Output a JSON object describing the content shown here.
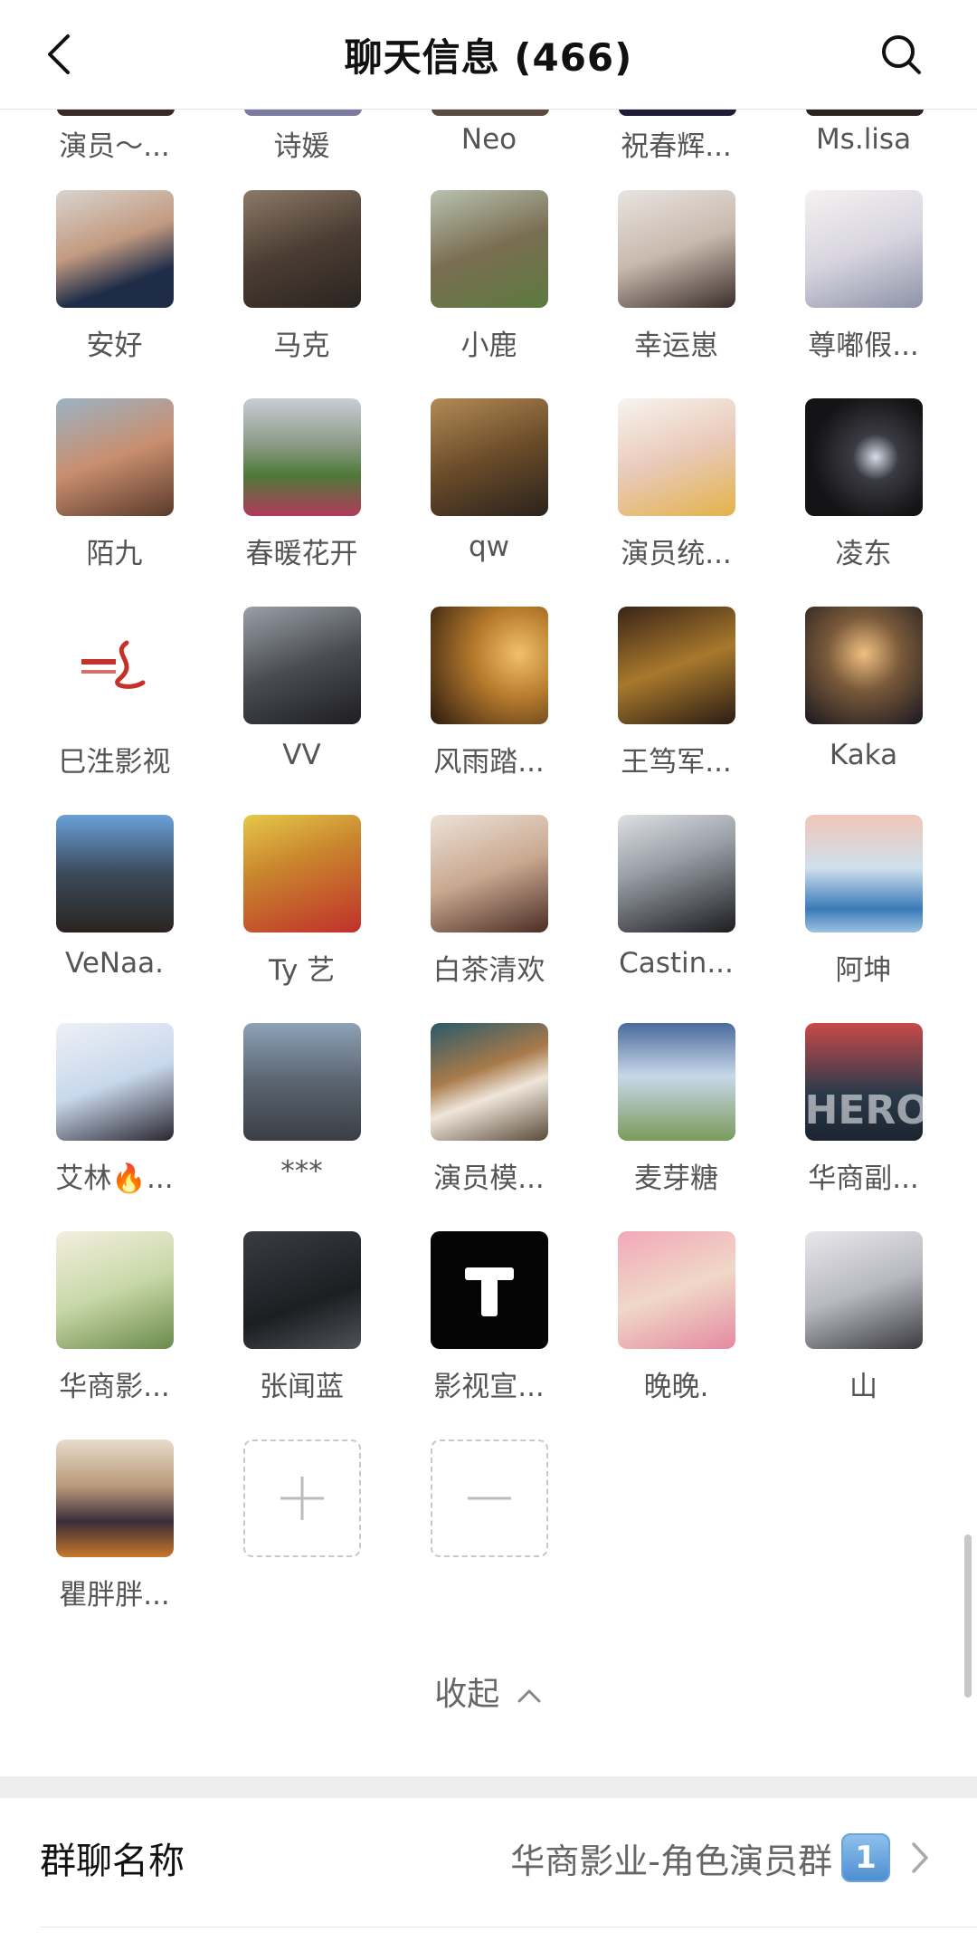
{
  "header": {
    "title": "聊天信息 (466)"
  },
  "partial_row": [
    {
      "name": "演员～...",
      "color": "#3a2a26"
    },
    {
      "name": "诗媛",
      "color": "#7d7aa0"
    },
    {
      "name": "Neo",
      "color": "#5a4a3f"
    },
    {
      "name": "祝春辉...",
      "color": "#1f1c3a"
    },
    {
      "name": "Ms.lisa",
      "color": "#2c2323"
    }
  ],
  "members": [
    {
      "name": "安好",
      "icon": "avatar-photo",
      "bg": "linear-gradient(160deg,#d9d4cf 0%,#c29a80 45%,#1e2c48 75%)"
    },
    {
      "name": "马克",
      "icon": "avatar-photo",
      "bg": "linear-gradient(160deg,#8c7a68 0%,#4b3d33 50%,#2a2420 100%)"
    },
    {
      "name": "小鹿",
      "icon": "avatar-photo",
      "bg": "linear-gradient(160deg,#b8c2b0 0%,#7a6e52 50%,#5c7a3e 100%)"
    },
    {
      "name": "幸运崽",
      "icon": "avatar-photo",
      "bg": "linear-gradient(160deg,#e8e4e0 0%,#c9b9ad 50%,#3a2e2a 100%)"
    },
    {
      "name": "尊嘟假...",
      "icon": "avatar-illustration",
      "bg": "linear-gradient(160deg,#f4f2f0 0%,#d8d5e0 50%,#8e93a8 100%)"
    },
    {
      "name": "陌九",
      "icon": "avatar-illustration",
      "bg": "linear-gradient(160deg,#9ab3c4 0%,#c98e6e 50%,#5a3a2c 100%)"
    },
    {
      "name": "春暖花开",
      "icon": "avatar-photo",
      "bg": "linear-gradient(180deg,#c9ced6 0%,#8a9a84 40%,#4e7a3a 65%,#b03a5a 100%)"
    },
    {
      "name": "qw",
      "icon": "avatar-photo",
      "bg": "linear-gradient(160deg,#b28a55 0%,#6b4c2a 50%,#2a221c 100%)"
    },
    {
      "name": "演员统...",
      "icon": "avatar-illustration",
      "bg": "linear-gradient(160deg,#f7f4f0 0%,#e9c9b8 50%,#e3b34a 100%)"
    },
    {
      "name": "凌东",
      "icon": "avatar-photo",
      "bg": "radial-gradient(circle at 60% 50%,#d8dde8 0%,#3a3a42 25%,#141416 70%)"
    },
    {
      "name": "巳泩影视",
      "icon": "logo",
      "bg": "#ffffff"
    },
    {
      "name": "VV",
      "icon": "avatar-photo",
      "bg": "linear-gradient(160deg,#9aa0a8 0%,#4a4c52 50%,#1e1e22 100%)"
    },
    {
      "name": "风雨踏...",
      "icon": "avatar-photo",
      "bg": "radial-gradient(circle at 75% 40%,#f2c06a 0%,#b57a2c 40%,#2a1a10 100%)"
    },
    {
      "name": "王笃军...",
      "icon": "avatar-photo",
      "bg": "linear-gradient(160deg,#3a2418 0%,#a8792c 50%,#2a1c14 100%)"
    },
    {
      "name": "Kaka",
      "icon": "avatar-illustration",
      "bg": "radial-gradient(circle at 50% 40%,#f0c080 0%,#7a5a3a 40%,#1a1820 100%)"
    },
    {
      "name": "VeNaa.",
      "icon": "avatar-photo",
      "bg": "linear-gradient(180deg,#6aa0d8 0%,#3a4a5a 50%,#2a2420 100%)"
    },
    {
      "name": "Ty 艺",
      "icon": "avatar-photo",
      "bg": "linear-gradient(160deg,#e6c84a 0%,#c9862e 40%,#c0302a 100%)"
    },
    {
      "name": "白茶清欢",
      "icon": "avatar-illustration",
      "bg": "linear-gradient(160deg,#ece2d8 0%,#c9a890 50%,#4a2c24 100%)"
    },
    {
      "name": "Castin...",
      "icon": "avatar-illustration",
      "bg": "linear-gradient(160deg,#dde0e4 0%,#9aa0a8 40%,#1c1c20 100%)"
    },
    {
      "name": "阿坤",
      "icon": "avatar-illustration",
      "bg": "linear-gradient(180deg,#f0c6b8 0%,#cfe0ec 45%,#3a7ab8 80%,#9cc2e0 100%)"
    },
    {
      "name": "艾林🔥...",
      "icon": "avatar-photo",
      "bg": "linear-gradient(160deg,#eef0f6 0%,#c8d8ec 50%,#2a2630 100%)"
    },
    {
      "name": "***",
      "icon": "avatar-photo",
      "bg": "linear-gradient(180deg,#8ea2b8 0%,#5a6470 50%,#3a3e44 100%)"
    },
    {
      "name": "演员模...",
      "icon": "avatar-illustration",
      "bg": "linear-gradient(160deg,#2a5a6a 0%,#a87a4a 40%,#efe6da 60%,#5a4a3a 100%)"
    },
    {
      "name": "麦芽糖",
      "icon": "avatar-photo",
      "bg": "linear-gradient(180deg,#4a6a9a 0%,#c8d8ea 45%,#7a9a5a 100%)"
    },
    {
      "name": "华商副...",
      "icon": "avatar-illustration",
      "bg": "linear-gradient(180deg,#c84a4a 0%,#2a3a4a 60%,#1c2430 100%)",
      "glyph": "HERO"
    },
    {
      "name": "华商影...",
      "icon": "avatar-illustration",
      "bg": "linear-gradient(160deg,#f4efe0 0%,#c8d8a8 50%,#6a8a4a 100%)"
    },
    {
      "name": "张闻蓝",
      "icon": "avatar-photo",
      "bg": "linear-gradient(160deg,#3a3c42 0%,#1c1e22 60%,#505258 100%)"
    },
    {
      "name": "影视宣...",
      "icon": "logo",
      "bg": "#050505",
      "glyph": "T"
    },
    {
      "name": "晚晚.",
      "icon": "avatar-illustration",
      "bg": "linear-gradient(160deg,#f2a8b8 0%,#f0d8c8 50%,#e48aa0 100%)"
    },
    {
      "name": "山",
      "icon": "avatar-illustration",
      "bg": "linear-gradient(160deg,#e8e8ec 0%,#b8b8c0 50%,#3a3a40 100%)"
    },
    {
      "name": "瞿胖胖...",
      "icon": "avatar-photo",
      "bg": "linear-gradient(180deg,#e8dccb 0%,#b89878 40%,#3a2c3a 70%,#c8782a 100%)"
    }
  ],
  "actions": {
    "add_icon": "plus-icon",
    "remove_icon": "minus-icon"
  },
  "collapse": {
    "label": "收起"
  },
  "group_name": {
    "label": "群聊名称",
    "value": "华商影业-角色演员群",
    "badge": "1"
  },
  "colors": {
    "text_primary": "#111111",
    "text_secondary": "#555555",
    "divider": "#ededed"
  }
}
